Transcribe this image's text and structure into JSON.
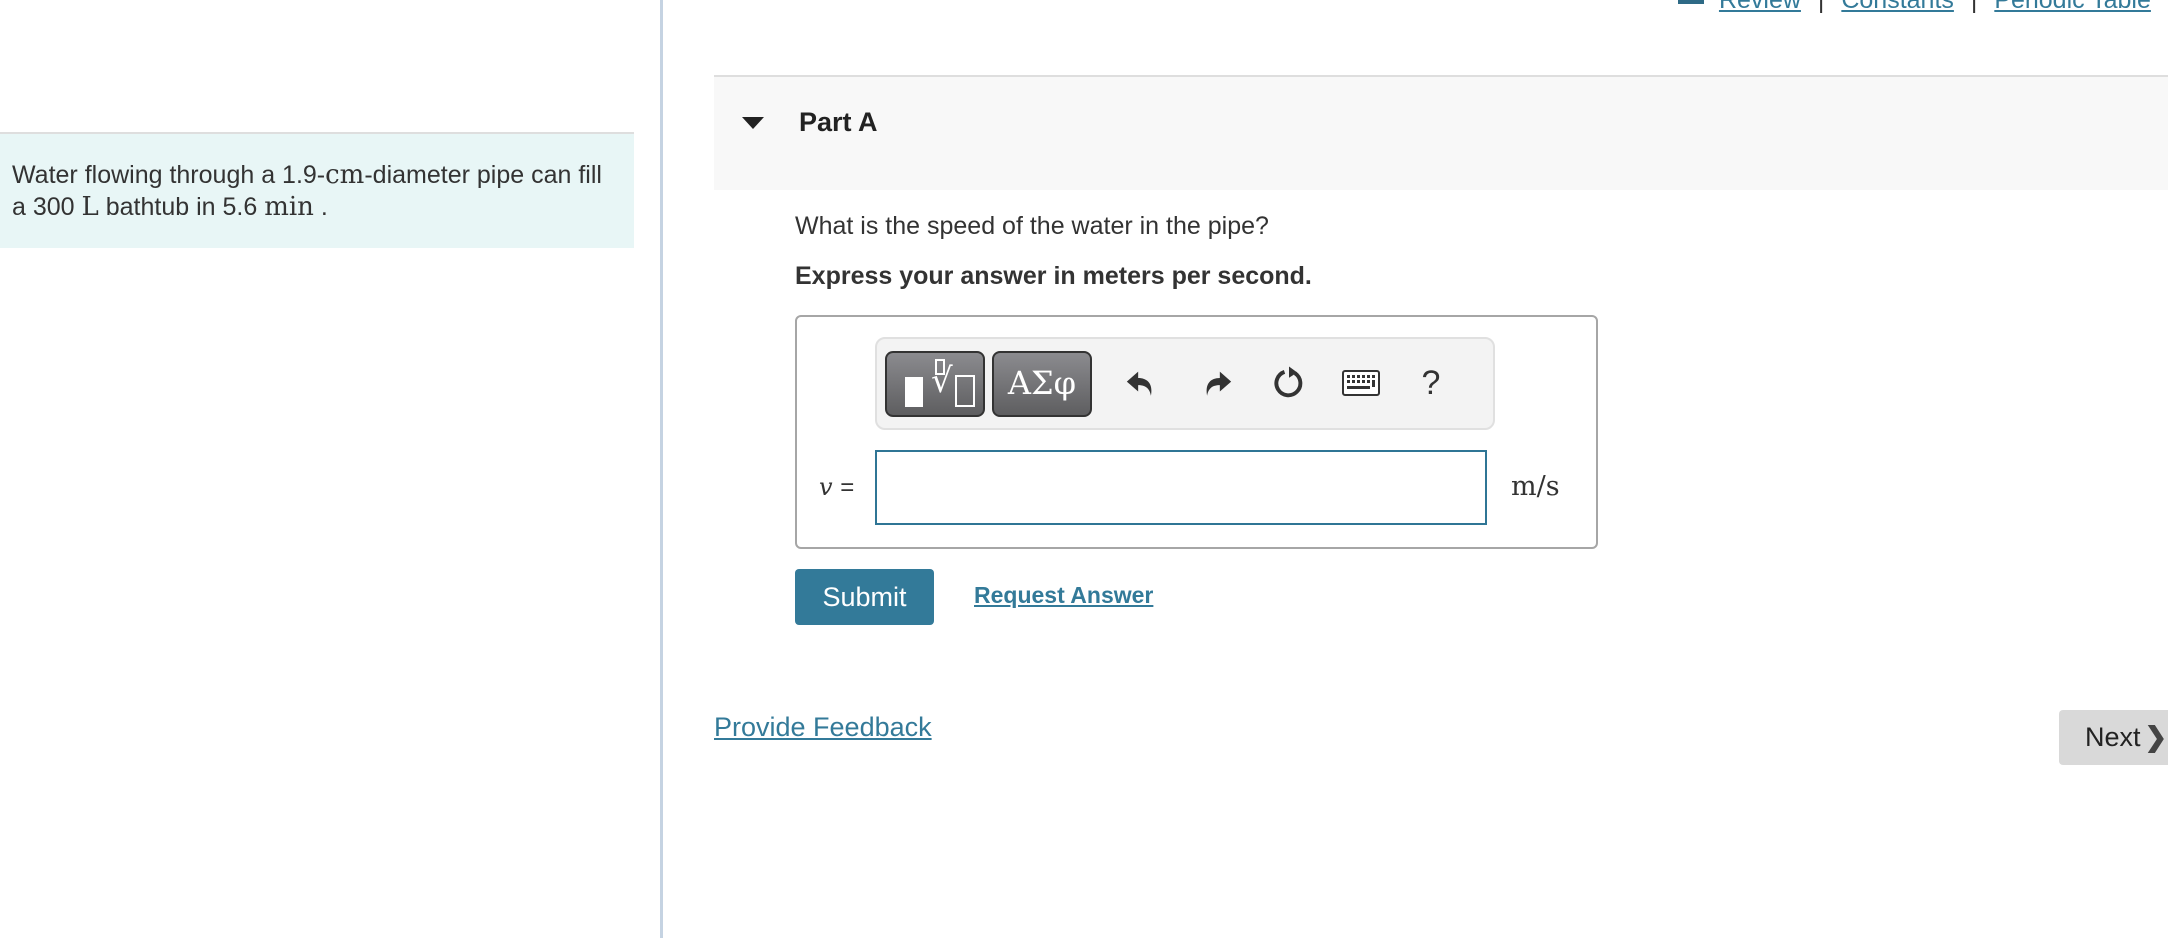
{
  "top_links": {
    "review": "Review",
    "constants": "Constants",
    "periodic_table": "Periodic Table",
    "separator": "|"
  },
  "intro": {
    "text_before_cm": "Water flowing through a 1.9-",
    "unit_cm": "cm",
    "text_after_cm": "-diameter pipe can fill a 300 ",
    "unit_L": "L",
    "text_mid": " bathtub in 5.6 ",
    "unit_min": "min",
    "text_end": " ."
  },
  "part": {
    "title": "Part A",
    "question": "What is the speed of the water in the pipe?",
    "instruction": "Express your answer in meters per second."
  },
  "toolbar": {
    "greek_label": "ΑΣφ",
    "undo": "undo-icon",
    "redo": "redo-icon",
    "reset": "reset-icon",
    "keyboard": "keyboard-icon",
    "help_label": "?"
  },
  "answer": {
    "variable": "v",
    "equals": "=",
    "value": "",
    "unit": "m/s"
  },
  "actions": {
    "submit_label": "Submit",
    "request_answer_label": "Request Answer",
    "feedback_label": "Provide Feedback",
    "next_label": "Next",
    "next_chevron": "❯"
  }
}
